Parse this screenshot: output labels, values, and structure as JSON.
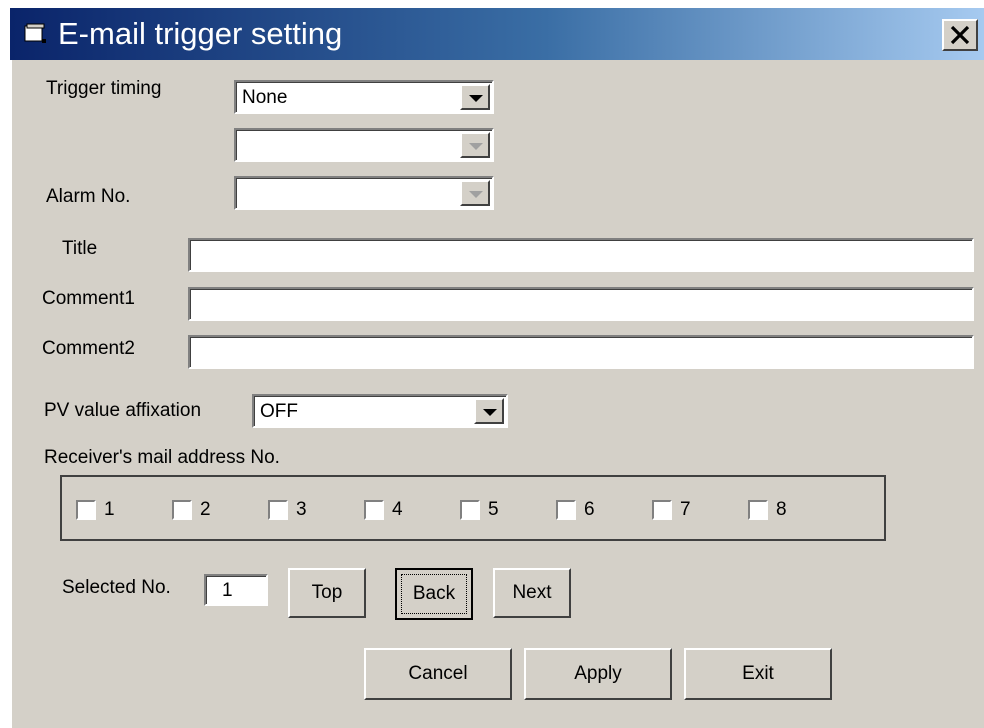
{
  "window": {
    "title": "E-mail trigger setting"
  },
  "icons": {
    "window_icon": "window-icon",
    "close": "close-icon"
  },
  "labels": {
    "trigger_timing": "Trigger timing",
    "alarm_no": "Alarm No.",
    "title": "Title",
    "comment1": "Comment1",
    "comment2": "Comment2",
    "pv_value_affixation": "PV value affixation",
    "receiver_mail_address_no": "Receiver's mail address No.",
    "selected_no": "Selected No."
  },
  "fields": {
    "trigger_timing": "None",
    "trigger_timing_2": "",
    "alarm_no": "",
    "title": "",
    "comment1": "",
    "comment2": "",
    "pv_value_affixation": "OFF",
    "selected_no": "1"
  },
  "receivers": [
    {
      "label": "1",
      "checked": false
    },
    {
      "label": "2",
      "checked": false
    },
    {
      "label": "3",
      "checked": false
    },
    {
      "label": "4",
      "checked": false
    },
    {
      "label": "5",
      "checked": false
    },
    {
      "label": "6",
      "checked": false
    },
    {
      "label": "7",
      "checked": false
    },
    {
      "label": "8",
      "checked": false
    }
  ],
  "buttons": {
    "top": "Top",
    "back": "Back",
    "next": "Next",
    "cancel": "Cancel",
    "apply": "Apply",
    "exit": "Exit"
  }
}
